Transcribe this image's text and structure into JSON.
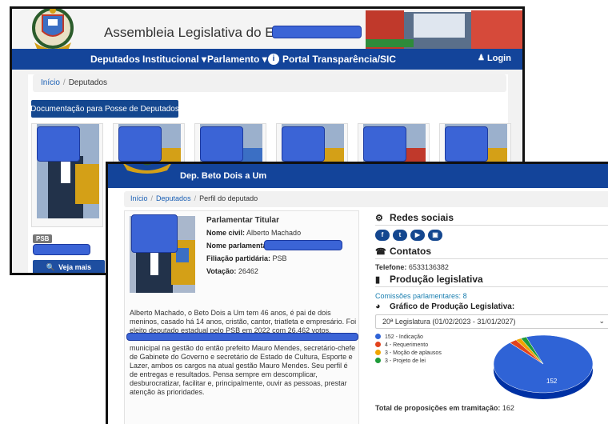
{
  "back_window": {
    "header_title": "Assembleia Legislativa do Estado d",
    "nav": [
      {
        "label": "Deputados"
      },
      {
        "label": "Institucional ▾"
      },
      {
        "label": "Parlamento ▾"
      },
      {
        "label": "Portal Transparência/SIC"
      }
    ],
    "login_label": "Login",
    "breadcrumb": {
      "home": "Início",
      "current": "Deputados"
    },
    "doc_button": "Documentação para Posse de Deputados",
    "card_badge": "PSB",
    "card_button": "Veja mais"
  },
  "front_window": {
    "nav_title": "Dep. Beto Dois a Um",
    "breadcrumb": {
      "home": "Início",
      "section": "Deputados",
      "current": "Perfil do deputado"
    },
    "profile": {
      "role": "Parlamentar Titular",
      "civil_label": "Nome civil:",
      "civil_value": "Alberto Machado",
      "parl_label": "Nome parlamenta",
      "party_label": "Filiação partidária:",
      "party_value": "PSB",
      "votes_label": "Votação:",
      "votes_value": "26462"
    },
    "bio_top": "Alberto Machado, o Beto Dois a Um tem 46 anos, é pai de dois meninos, casado há 14 anos, cristão, cantor, triatleta e empresário. Foi eleito deputado estadual pelo PSB em 2022 com 26.462 votos.",
    "bio_bottom": "municipal na gestão do então prefeito Mauro Mendes, secretário-chefe de Gabinete do Governo e secretário de Estado de Cultura, Esporte e Lazer, ambos os cargos na atual gestão Mauro Mendes. Seu perfil é de entregas e resultados. Pensa sempre em descomplicar, desburocratizar, facilitar e, principalmente, ouvir as pessoas, prestar atenção às prioridades.",
    "social_title": "Redes sociais",
    "social_icons": [
      "facebook-icon",
      "twitter-icon",
      "youtube-icon",
      "instagram-icon"
    ],
    "contacts_title": "Contatos",
    "phone_label": "Telefone:",
    "phone_value": "6533136382",
    "production_title": "Produção legislativa",
    "commissions_label": "Comissões parlamentares:",
    "commissions_value": "8",
    "chart_title": "Gráfico de Produção Legislativa:",
    "legislature_select": "20ª Legislatura (01/02/2023 - 31/01/2027)",
    "total_label": "Total de proposições em tramitação:",
    "total_value": "162"
  },
  "chart_data": {
    "type": "pie",
    "title": "",
    "categories": [
      "Indicação",
      "Requerimento",
      "Moção de aplausos",
      "Projeto de lei"
    ],
    "values": [
      152,
      4,
      3,
      3
    ],
    "legend_labels": [
      "152 - Indicação",
      "4 - Requerimento",
      "3 - Moção de aplausos",
      "3 - Projeto de lei"
    ],
    "colors": [
      "#2f63d6",
      "#e2431d",
      "#f0a500",
      "#1e9b3a"
    ],
    "data_label": "152",
    "legend_placement": "top-left"
  },
  "colors": {
    "nav_blue": "#13449a",
    "link_blue": "#1a5fb4",
    "redaction_blue": "#3b64d6"
  }
}
